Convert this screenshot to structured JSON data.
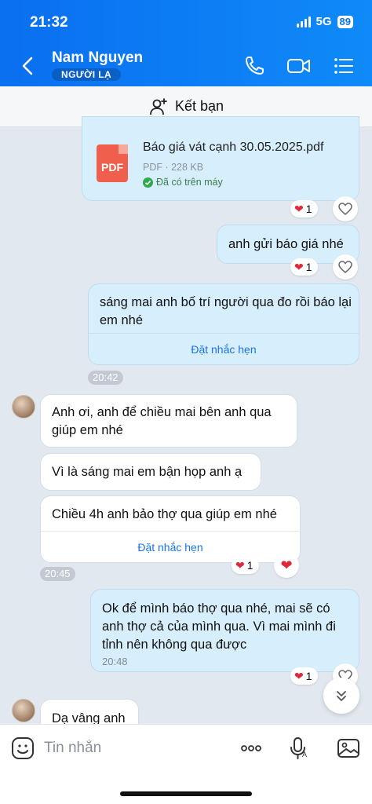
{
  "status": {
    "time": "21:32",
    "network": "5G",
    "battery": "89"
  },
  "header": {
    "name": "Nam Nguyen",
    "badge": "NGƯỜI LẠ"
  },
  "add_friend": {
    "label": "Kết bạn"
  },
  "file": {
    "name": "Báo giá vát cạnh 30.05.2025.pdf",
    "type_icon": "PDF",
    "meta": "PDF · 228 KB",
    "status": "Đã có trên máy",
    "reactions": "1"
  },
  "messages": {
    "m1": {
      "text": "anh gửi báo giá nhé",
      "reactions": "1"
    },
    "m2": {
      "text": "sáng mai anh bố trí người qua đo rồi báo lại em nhé",
      "remind": "Đặt nhắc hẹn",
      "time": "20:42"
    },
    "m3": {
      "text": "Anh ơi, anh để chiều mai bên anh qua giúp em nhé"
    },
    "m4": {
      "text": "Vì là sáng mai em bận họp anh ạ"
    },
    "m5": {
      "text": "Chiều 4h anh bảo thợ qua giúp em nhé",
      "remind": "Đặt nhắc hẹn",
      "time": "20:45",
      "reactions": "1"
    },
    "m6": {
      "text": "Ok để mình báo thợ qua nhé, mai sẽ có anh thợ cả của mình qua. Vì mai mình đi tỉnh nên không qua được",
      "time": "20:48",
      "reactions": "1"
    },
    "m7": {
      "text": "Dạ vâng anh"
    }
  },
  "composer": {
    "placeholder": "Tin nhắn"
  },
  "colors": {
    "header": "#0a72f1",
    "my_bubble": "#d7eefc",
    "link": "#1b74e4",
    "heart": "#e0283c"
  }
}
